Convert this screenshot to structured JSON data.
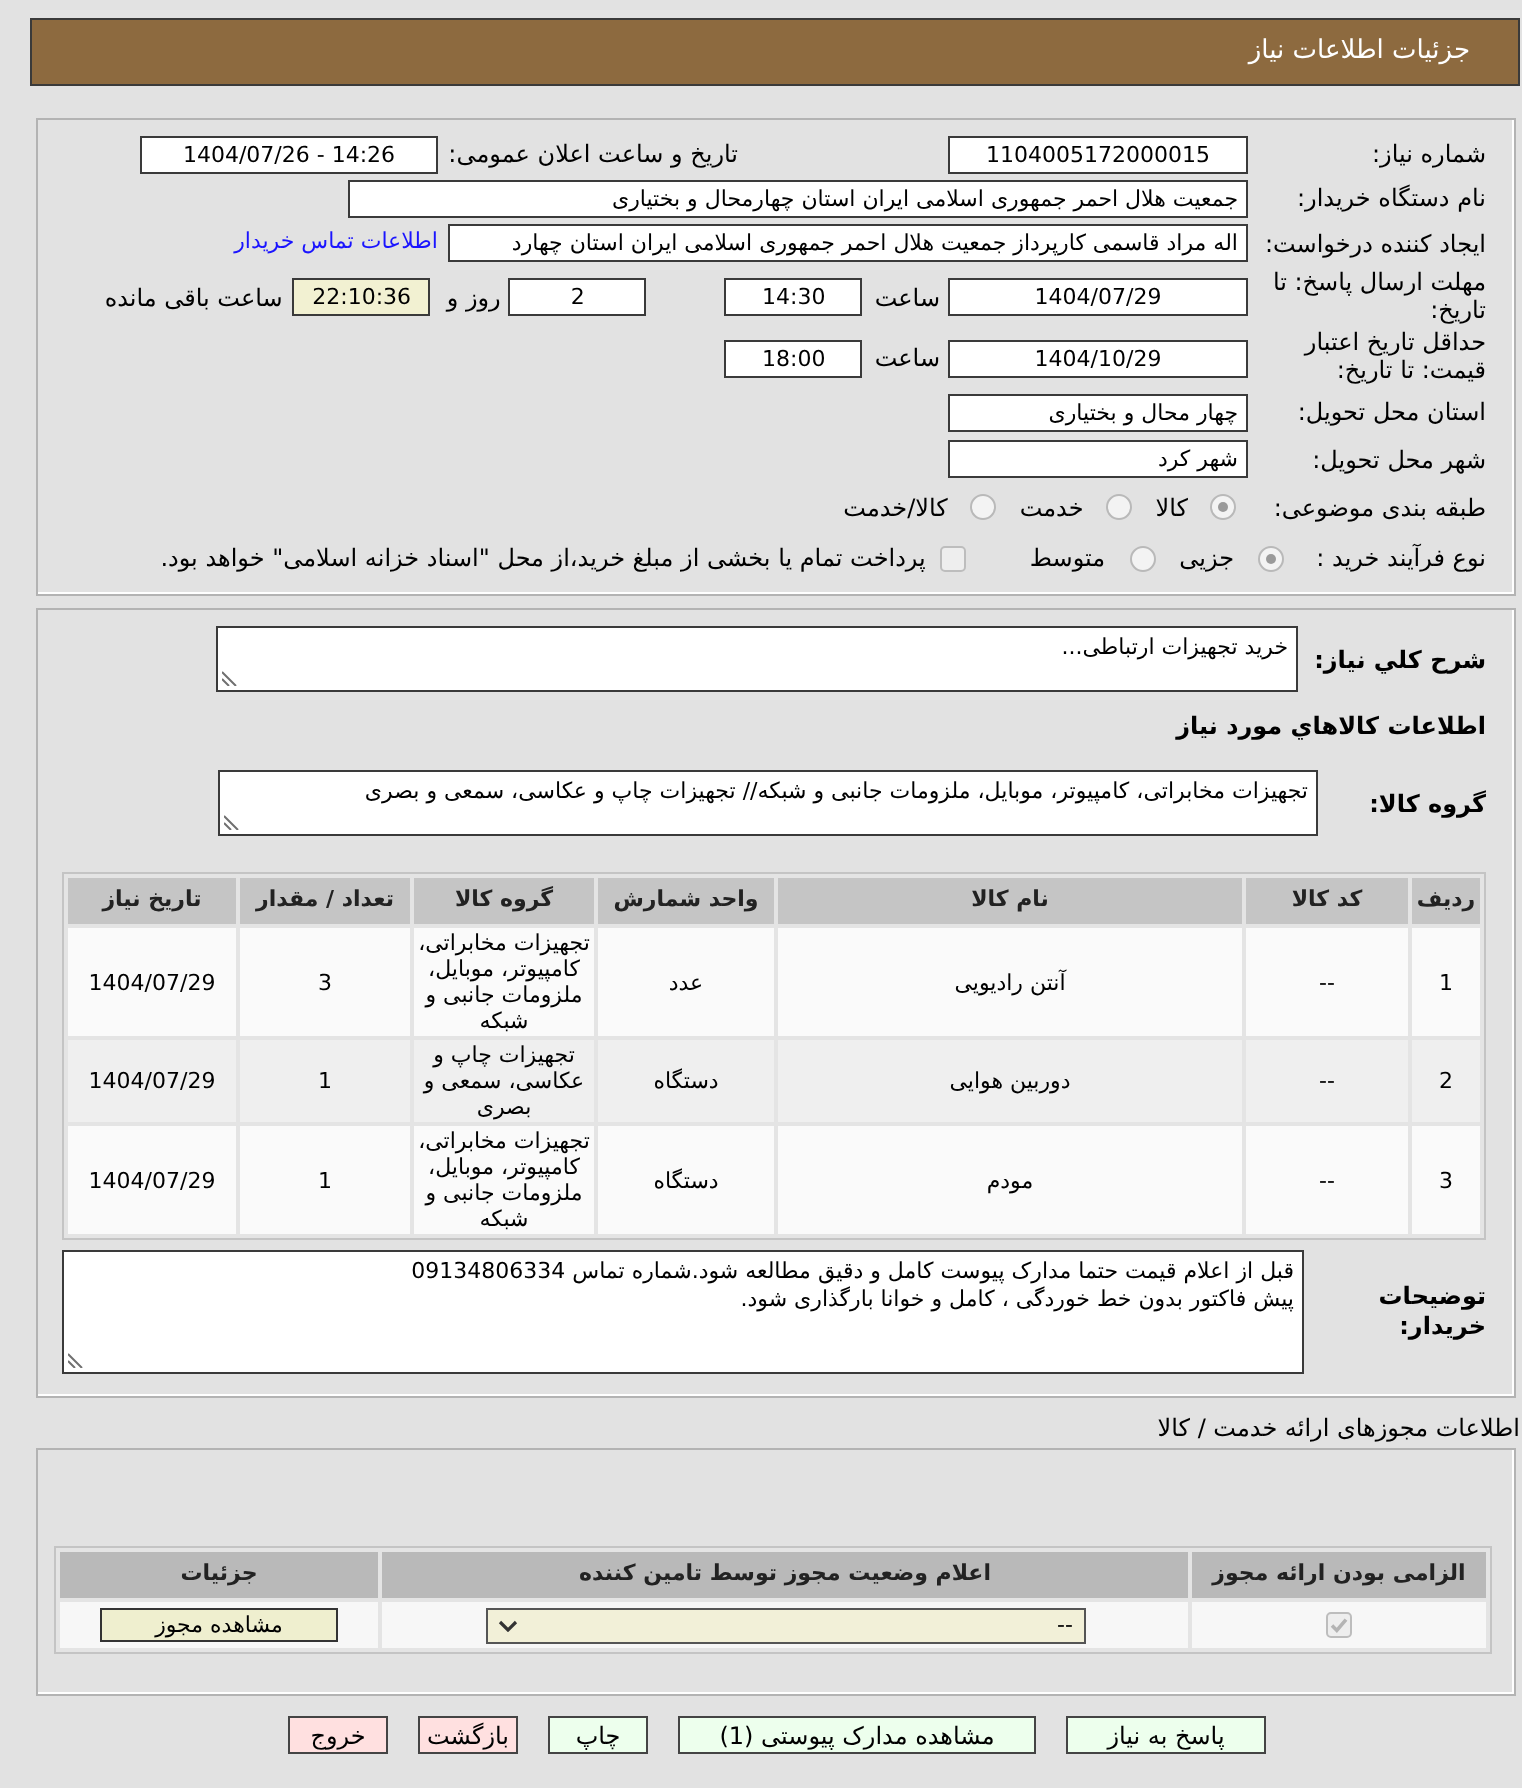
{
  "header": {
    "title": "جزئیات اطلاعات نیاز"
  },
  "details": {
    "need_number": {
      "label": "شماره نیاز:",
      "value": "1104005172000015"
    },
    "announcement": {
      "label": "تاریخ و ساعت اعلان عمومی:",
      "value": "1404/07/26 - 14:26"
    },
    "buyer_org": {
      "label": "نام دستگاه خریدار:",
      "value": "جمعیت هلال احمر جمهوری اسلامی ایران استان چهارمحال و بختیاری"
    },
    "requester": {
      "label": "ایجاد کننده درخواست:",
      "value": "اله مراد قاسمی کارپرداز جمعیت هلال احمر جمهوری اسلامی ایران استان چهارد",
      "contact_link": "اطلاعات تماس خریدار"
    },
    "response_deadline": {
      "label": "مهلت ارسال پاسخ: تا تاریخ:",
      "date": "1404/07/29",
      "time_label": "ساعت",
      "time": "14:30",
      "days": "2",
      "days_label": "روز و",
      "remaining": "22:10:36",
      "remaining_label": "ساعت باقی مانده"
    },
    "price_validity": {
      "label": "حداقل تاریخ اعتبار قیمت: تا تاریخ:",
      "date": "1404/10/29",
      "time_label": "ساعت",
      "time": "18:00"
    },
    "delivery_province": {
      "label": "استان محل تحویل:",
      "value": "چهار محال و بختیاری"
    },
    "delivery_city": {
      "label": "شهر محل تحویل:",
      "value": "شهر کرد"
    },
    "subject_category": {
      "label": "طبقه بندی موضوعی:",
      "options": [
        {
          "label": "کالا",
          "selected": true
        },
        {
          "label": "خدمت",
          "selected": false
        },
        {
          "label": "کالا/خدمت",
          "selected": false
        }
      ]
    },
    "purchase_process": {
      "label": "نوع فرآیند خرید :",
      "options": [
        {
          "label": "جزیی",
          "selected": true
        },
        {
          "label": "متوسط",
          "selected": false
        }
      ],
      "treasury_payment": {
        "label": "پرداخت تمام یا بخشی از مبلغ خرید،از محل \"اسناد خزانه اسلامی\" خواهد بود.",
        "checked": false
      }
    }
  },
  "need": {
    "summary": {
      "label": "شرح کلي نياز:",
      "value": "خرید تجهیزات ارتباطی..."
    },
    "goods_heading": "اطلاعات کالاهاي مورد نياز",
    "goods_group": {
      "label": "گروه کالا:",
      "value": "تجهیزات مخابراتی، کامپیوتر، موبایل، ملزومات جانبی و شبکه// تجهیزات چاپ و عکاسی، سمعی و بصری"
    },
    "items_table": {
      "columns": [
        "ردیف",
        "کد کالا",
        "نام کالا",
        "واحد شمارش",
        "گروه کالا",
        "تعداد / مقدار",
        "تاریخ نیاز"
      ],
      "rows": [
        [
          "1",
          "--",
          "آنتن رادیویی",
          "عدد",
          "تجهیزات مخابراتی، کامپیوتر، موبایل، ملزومات جانبی و شبکه",
          "3",
          "1404/07/29"
        ],
        [
          "2",
          "--",
          "دوربین هوایی",
          "دستگاه",
          "تجهیزات چاپ و عکاسی، سمعی و بصری",
          "1",
          "1404/07/29"
        ],
        [
          "3",
          "--",
          "مودم",
          "دستگاه",
          "تجهیزات مخابراتی، کامپیوتر، موبایل، ملزومات جانبی و شبکه",
          "1",
          "1404/07/29"
        ]
      ]
    },
    "buyer_notes": {
      "label": "توضیحات خریدار:",
      "value": "قبل از اعلام قیمت حتما مدارک پیوست کامل و دقیق مطالعه شود.شماره تماس 09134806334\nپیش فاکتور بدون خط خوردگی ، کامل و خوانا بارگذاری شود."
    }
  },
  "permits": {
    "title": "اطلاعات مجوزهای ارائه خدمت / کالا",
    "columns": [
      "الزامی بودن ارائه مجوز",
      "اعلام وضعیت مجوز توسط تامین کننده",
      "جزئیات"
    ],
    "rows": [
      {
        "required": true,
        "status": "--",
        "button": "مشاهده مجوز"
      }
    ]
  },
  "buttons": [
    {
      "label": "پاسخ به نیاز",
      "kind": "confirm"
    },
    {
      "label": "مشاهده مدارک پیوستی (1)",
      "kind": "confirm"
    },
    {
      "label": "چاپ",
      "kind": "confirm"
    },
    {
      "label": "بازگشت",
      "kind": "cancel"
    },
    {
      "label": "خروج",
      "kind": "cancel"
    }
  ]
}
